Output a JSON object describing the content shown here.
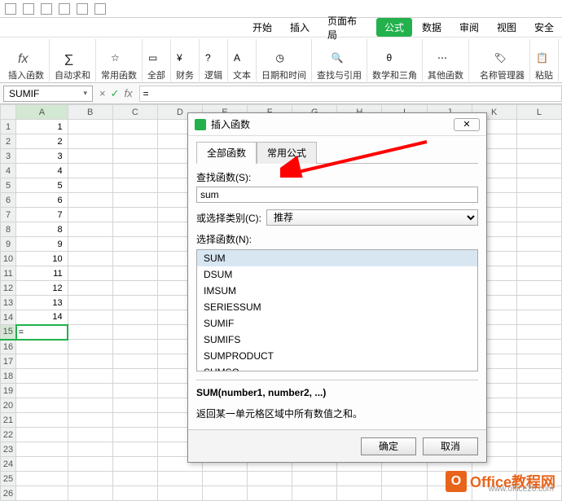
{
  "menu": {
    "items": [
      "开始",
      "插入",
      "页面布局",
      "公式",
      "数据",
      "审阅",
      "视图",
      "安全"
    ],
    "active_index": 3
  },
  "ribbon": {
    "groups": [
      {
        "label": "插入函数",
        "kind": "fx"
      },
      {
        "label": "自动求和",
        "kind": "sigma"
      },
      {
        "label": "常用函数",
        "kind": "star"
      },
      {
        "label": "全部",
        "kind": "all"
      },
      {
        "label": "财务",
        "kind": "fin"
      },
      {
        "label": "逻辑",
        "kind": "logic"
      },
      {
        "label": "文本",
        "kind": "text"
      },
      {
        "label": "日期和时间",
        "kind": "date"
      },
      {
        "label": "查找与引用",
        "kind": "lookup"
      },
      {
        "label": "数学和三角",
        "kind": "math"
      },
      {
        "label": "其他函数",
        "kind": "other"
      }
    ],
    "right": [
      {
        "label": "名称管理器"
      },
      {
        "label": ""
      },
      {
        "label": "粘贴"
      }
    ]
  },
  "namebox": {
    "value": "SUMIF"
  },
  "formulabar": {
    "buttons": [
      "×",
      "✓",
      "fx"
    ],
    "value": "="
  },
  "columns": [
    "A",
    "B",
    "C",
    "D",
    "E",
    "F",
    "G",
    "H",
    "I",
    "J",
    "K",
    "L"
  ],
  "rows": [
    {
      "n": 1,
      "A": "1"
    },
    {
      "n": 2,
      "A": "2"
    },
    {
      "n": 3,
      "A": "3"
    },
    {
      "n": 4,
      "A": "4"
    },
    {
      "n": 5,
      "A": "5"
    },
    {
      "n": 6,
      "A": "6"
    },
    {
      "n": 7,
      "A": "7"
    },
    {
      "n": 8,
      "A": "8"
    },
    {
      "n": 9,
      "A": "9"
    },
    {
      "n": 10,
      "A": "10"
    },
    {
      "n": 11,
      "A": "11"
    },
    {
      "n": 12,
      "A": "12"
    },
    {
      "n": 13,
      "A": "13"
    },
    {
      "n": 14,
      "A": "14"
    },
    {
      "n": 15,
      "A": "="
    },
    {
      "n": 16,
      "A": ""
    },
    {
      "n": 17,
      "A": ""
    },
    {
      "n": 18,
      "A": ""
    },
    {
      "n": 19,
      "A": ""
    },
    {
      "n": 20,
      "A": ""
    },
    {
      "n": 21,
      "A": ""
    },
    {
      "n": 22,
      "A": ""
    },
    {
      "n": 23,
      "A": ""
    },
    {
      "n": 24,
      "A": ""
    },
    {
      "n": 25,
      "A": ""
    },
    {
      "n": 26,
      "A": ""
    }
  ],
  "active_row": 15,
  "dialog": {
    "title": "插入函数",
    "tabs": [
      "全部函数",
      "常用公式"
    ],
    "active_tab": 0,
    "search_label": "查找函数(S):",
    "search_value": "sum",
    "category_label": "或选择类别(C):",
    "category_value": "推荐",
    "select_label": "选择函数(N):",
    "functions": [
      "SUM",
      "DSUM",
      "IMSUM",
      "SERIESSUM",
      "SUMIF",
      "SUMIFS",
      "SUMPRODUCT",
      "SUMSQ"
    ],
    "selected_fn": 0,
    "signature": "SUM(number1, number2, ...)",
    "description": "返回某一单元格区域中所有数值之和。",
    "ok": "确定",
    "cancel": "取消"
  },
  "watermark": {
    "brand_cn": "Office教程网",
    "url": "www.office26.com"
  }
}
